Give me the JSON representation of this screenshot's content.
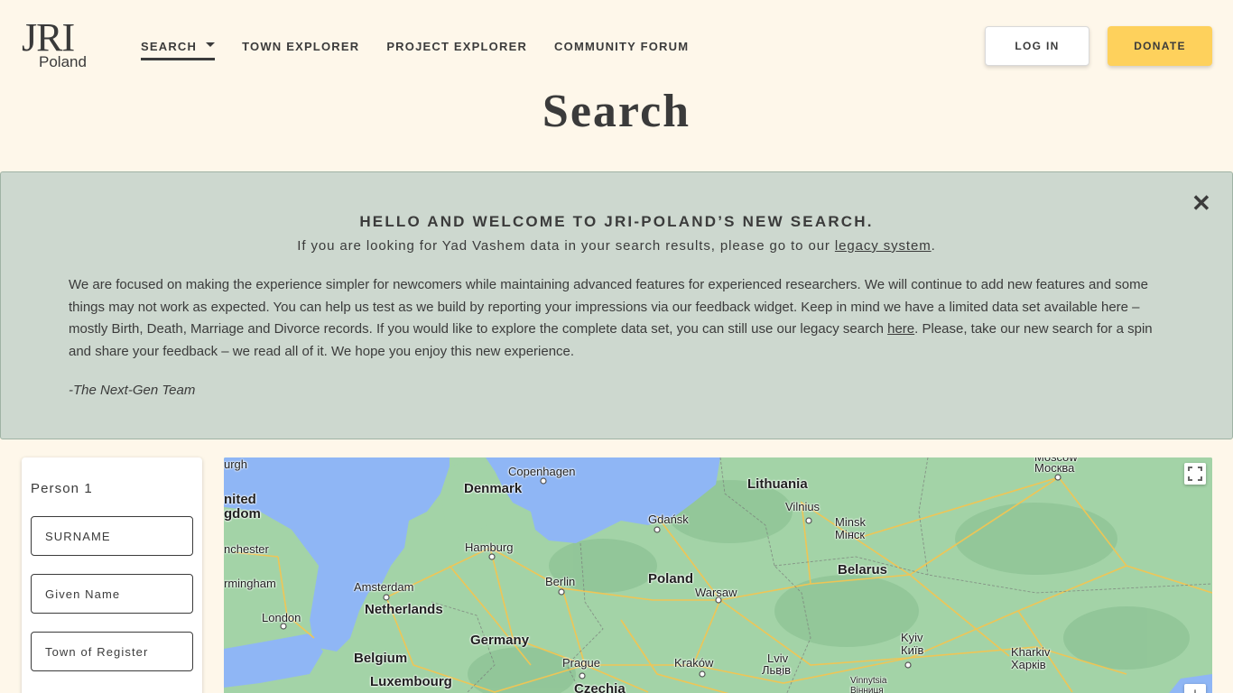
{
  "logo": {
    "line1": "JRI",
    "line2": "Poland"
  },
  "nav": {
    "items": [
      {
        "label": "SEARCH"
      },
      {
        "label": "TOWN EXPLORER"
      },
      {
        "label": "PROJECT EXPLORER"
      },
      {
        "label": "COMMUNITY FORUM"
      }
    ]
  },
  "header": {
    "login_label": "LOG IN",
    "donate_label": "DONATE"
  },
  "page": {
    "title": "Search"
  },
  "banner": {
    "heading": "HELLO AND WELCOME TO JRI-POLAND’S NEW SEARCH.",
    "sub_before": "If you are looking for Yad Vashem data in your search results, please go to our ",
    "sub_link": "legacy system",
    "sub_after": ".",
    "body_before": "We are focused on making the experience simpler for newcomers while maintaining advanced features for experienced researchers. We will continue to add new features and some things may not work as expected. You can help us test as we build by reporting your impressions via our feedback widget. Keep in mind we have a limited data set available here – mostly Birth, Death, Marriage and Divorce records. If you would like to explore the complete data set, you can still use our legacy search ",
    "body_link": "here",
    "body_after": ". Please, take our new search for a spin and share your feedback – we read all of it. We hope you enjoy this new experience.",
    "signature": "-The Next-Gen Team",
    "close_symbol": "✕"
  },
  "form": {
    "person_label": "Person 1",
    "surname_placeholder": "SURNAME",
    "given_placeholder": "Given Name",
    "town_placeholder": "Town of Register"
  },
  "map": {
    "labels": [
      {
        "text": "urgh",
        "cls": "town"
      },
      {
        "text": "nited",
        "cls": "country"
      },
      {
        "text": "gdom",
        "cls": "country"
      },
      {
        "text": "nchester",
        "cls": "town"
      },
      {
        "text": "rmingham",
        "cls": "town"
      },
      {
        "text": "London",
        "cls": "town"
      },
      {
        "text": "Copenhagen",
        "cls": "town"
      },
      {
        "text": "Denmark",
        "cls": "country"
      },
      {
        "text": "Hamburg",
        "cls": "town"
      },
      {
        "text": "Amsterdam",
        "cls": "town"
      },
      {
        "text": "Netherlands",
        "cls": "country"
      },
      {
        "text": "Belgium",
        "cls": "country"
      },
      {
        "text": "Luxembourg",
        "cls": "country"
      },
      {
        "text": "Germany",
        "cls": "country"
      },
      {
        "text": "Berlin",
        "cls": "town"
      },
      {
        "text": "Prague",
        "cls": "town"
      },
      {
        "text": "Czechia",
        "cls": "country"
      },
      {
        "text": "Gdańsk",
        "cls": "town"
      },
      {
        "text": "Poland",
        "cls": "country"
      },
      {
        "text": "Warsaw",
        "cls": "town"
      },
      {
        "text": "Kraków",
        "cls": "town"
      },
      {
        "text": "Lviv",
        "cls": "town"
      },
      {
        "text": "Львів",
        "cls": "town"
      },
      {
        "text": "Lithuania",
        "cls": "country"
      },
      {
        "text": "Vilnius",
        "cls": "town"
      },
      {
        "text": "Minsk",
        "cls": "town"
      },
      {
        "text": "Мінск",
        "cls": "town"
      },
      {
        "text": "Belarus",
        "cls": "country"
      },
      {
        "text": "Moscow",
        "cls": "town"
      },
      {
        "text": "Москва",
        "cls": "town"
      },
      {
        "text": "Kyiv",
        "cls": "town"
      },
      {
        "text": "Київ",
        "cls": "town"
      },
      {
        "text": "Kharkiv",
        "cls": "town"
      },
      {
        "text": "Харків",
        "cls": "town"
      },
      {
        "text": "Vinnytsia",
        "cls": "small"
      },
      {
        "text": "Вінниця",
        "cls": "small"
      }
    ],
    "zoom_in_symbol": "+"
  },
  "colors": {
    "background": "#fef7ea",
    "banner": "#cdd8cf",
    "donate": "#fed15c",
    "map_land": "#a3d3a7",
    "map_water": "#8fb6f5",
    "map_roads": "#f3c552"
  }
}
